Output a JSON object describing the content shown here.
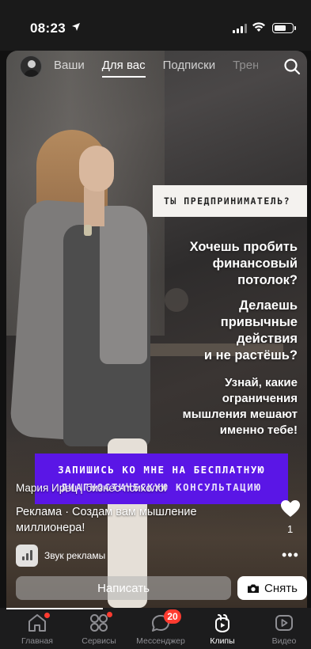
{
  "status_bar": {
    "time": "08:23"
  },
  "top_bar": {
    "tabs": [
      {
        "label": "Ваши",
        "active": false
      },
      {
        "label": "Для вас",
        "active": true
      },
      {
        "label": "Подписки",
        "active": false
      },
      {
        "label": "Тренд",
        "active": false
      }
    ]
  },
  "video": {
    "headline": "ТЫ ПРЕДПРИНИМАТЕЛЬ?",
    "lines_1": [
      "Хочешь пробить",
      "финансовый",
      "потолок?"
    ],
    "lines_2": [
      "Делаешь",
      "привычные",
      "действия",
      "и не растёшь?"
    ],
    "lines_3": [
      "Узнай, какие",
      "ограничения",
      "мышления мешают",
      "именно тебе!"
    ],
    "cta_line_1": "ЗАПИШИСЬ КО МНЕ НА БЕСПЛАТНУЮ",
    "cta_line_2": "ДИАГНОСТИЧЕСКУЮ КОНСУЛЬТАЦИЮ"
  },
  "post": {
    "author": "Мария Ирец | бизнес-психолог",
    "ad_text": "Реклама · Создам вам мышление миллионера!",
    "like_count": "1",
    "sound_label": "Звук рекламы"
  },
  "actions": {
    "write_label": "Написать",
    "shoot_label": "Снять"
  },
  "bottom_nav": {
    "items": [
      {
        "label": "Главная",
        "icon": "home-icon"
      },
      {
        "label": "Сервисы",
        "icon": "grid-icon"
      },
      {
        "label": "Мессенджер",
        "icon": "chat-icon",
        "badge": "20"
      },
      {
        "label": "Клипы",
        "icon": "clips-icon",
        "active": true
      },
      {
        "label": "Видео",
        "icon": "video-icon"
      }
    ]
  },
  "colors": {
    "cta_purple": "#5a16e6",
    "badge_red": "#ff3b30"
  }
}
